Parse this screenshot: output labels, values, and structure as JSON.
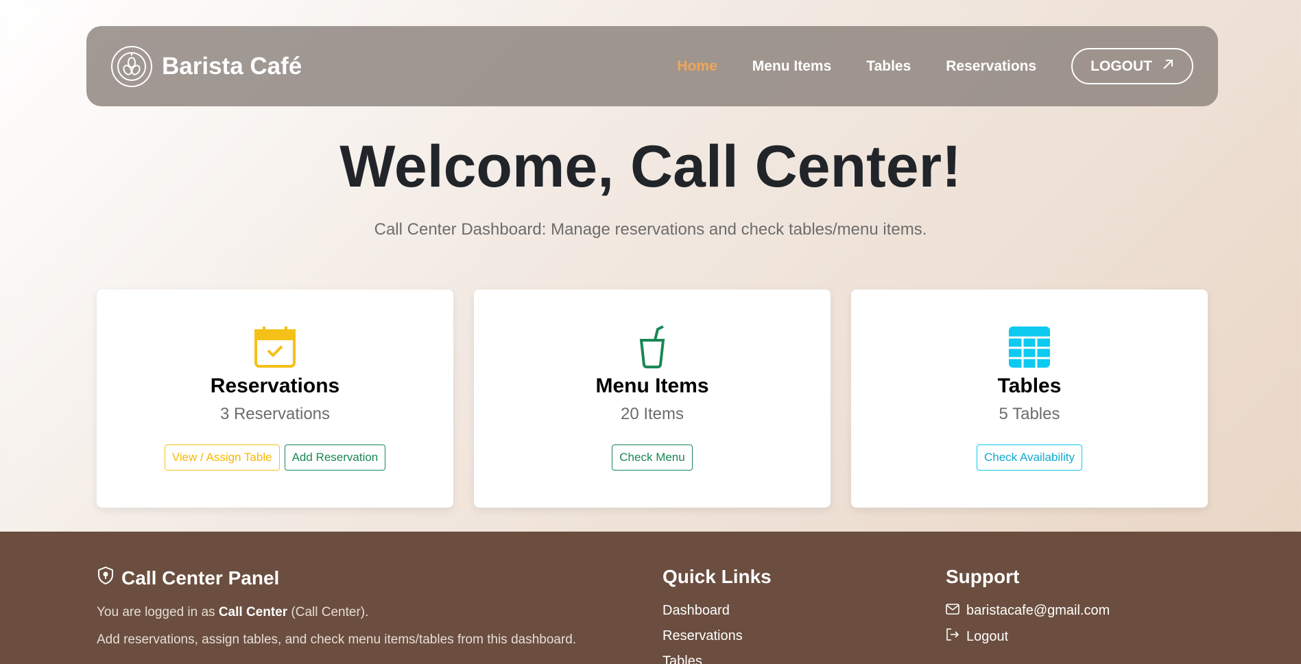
{
  "navbar": {
    "brand": "Barista Café",
    "links": [
      "Home",
      "Menu Items",
      "Tables",
      "Reservations"
    ],
    "logout_label": "LOGOUT"
  },
  "hero": {
    "title": "Welcome, Call Center!",
    "subtitle": "Call Center Dashboard: Manage reservations and check tables/menu items."
  },
  "cards": [
    {
      "icon": "calendar-check-icon",
      "title": "Reservations",
      "count": "3 Reservations",
      "buttons": [
        "View / Assign Table",
        "Add Reservation"
      ]
    },
    {
      "icon": "cup-straw-icon",
      "title": "Menu Items",
      "count": "20 Items",
      "buttons": [
        "Check Menu"
      ]
    },
    {
      "icon": "table-grid-icon",
      "title": "Tables",
      "count": "5 Tables",
      "buttons": [
        "Check Availability"
      ]
    }
  ],
  "footer": {
    "panel": {
      "title": "Call Center Panel",
      "logged_in_prefix": "You are logged in as ",
      "logged_in_user": "Call Center",
      "logged_in_suffix": " (Call Center).",
      "description": "Add reservations, assign tables, and check menu items/tables from this dashboard."
    },
    "quick_links": {
      "title": "Quick Links",
      "items": [
        "Dashboard",
        "Reservations",
        "Tables"
      ]
    },
    "support": {
      "title": "Support",
      "email": "baristacafe@gmail.com",
      "logout": "Logout"
    }
  },
  "colors": {
    "accent": "#f0a55a",
    "warning": "#f5c118",
    "success": "#198754",
    "info": "#0dcaf0",
    "footer_bg": "#6b4e3f"
  }
}
